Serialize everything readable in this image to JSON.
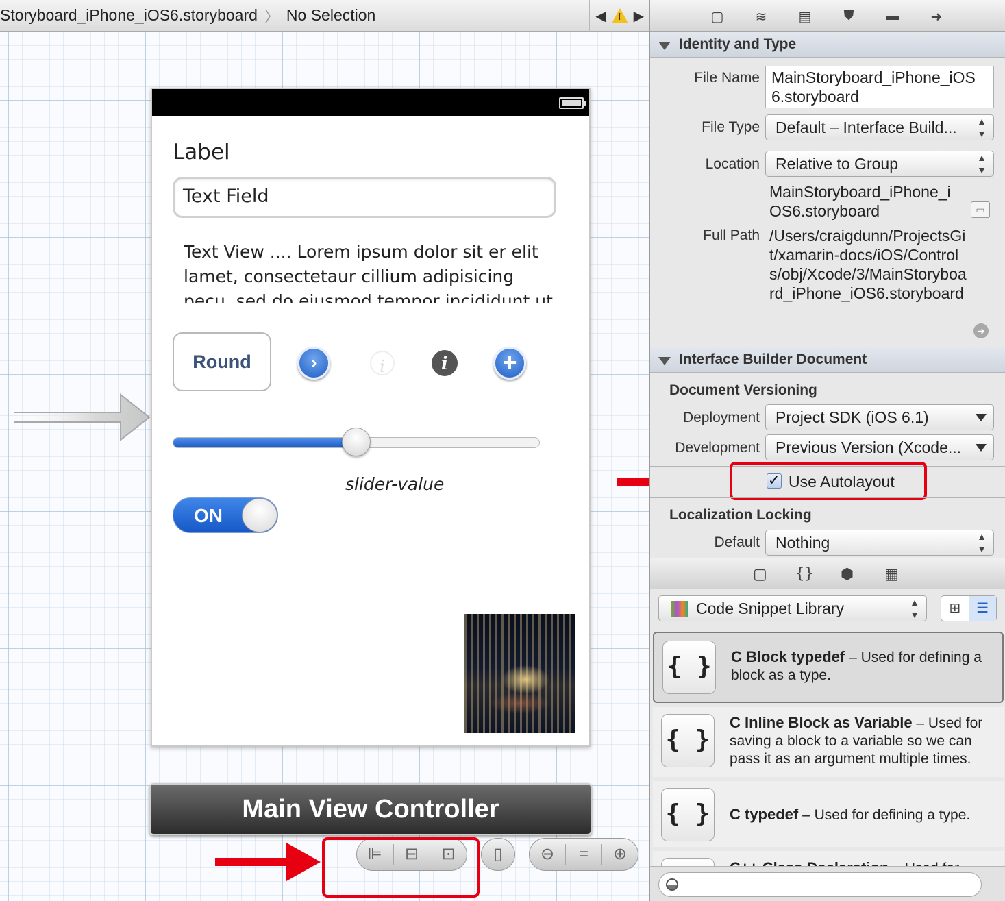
{
  "jumpbar": {
    "file": "Storyboard_iPhone_iOS6.storyboard",
    "selection": "No Selection"
  },
  "canvas": {
    "label": "Label",
    "text_field": "Text Field",
    "text_view": "Text View .... Lorem ipsum dolor sit er elit lamet, consectetaur cillium adipisicing pecu, sed do eiusmod tempor incididunt ut",
    "round_button": "Round",
    "slider_value_label": "slider-value",
    "slider_fraction": 0.5,
    "toggle_label": "ON",
    "view_controller_title": "Main View Controller"
  },
  "inspector": {
    "identity": {
      "header": "Identity and Type",
      "file_name_label": "File Name",
      "file_name": "MainStoryboard_iPhone_iOS6.storyboard",
      "file_type_label": "File Type",
      "file_type": "Default – Interface Build...",
      "location_label": "Location",
      "location": "Relative to Group",
      "relative_path": "MainStoryboard_iPhone_iOS6.storyboard",
      "full_path_label": "Full Path",
      "full_path": "/Users/craigdunn/ProjectsGit/xamarin-docs/iOS/Controls/obj/Xcode/3/MainStoryboard_iPhone_iOS6.storyboard"
    },
    "ib_doc": {
      "header": "Interface Builder Document",
      "versioning": "Document Versioning",
      "deployment_label": "Deployment",
      "deployment": "Project SDK (iOS 6.1)",
      "development_label": "Development",
      "development": "Previous Version (Xcode...",
      "autolayout": "Use Autolayout",
      "autolayout_checked": true,
      "localization": "Localization Locking",
      "default_label": "Default",
      "default_value": "Nothing"
    },
    "library": {
      "selector": "Code Snippet Library",
      "items": [
        {
          "title": "C Block typedef",
          "desc": "Used for defining a block as a type.",
          "icon": "{ }"
        },
        {
          "title": "C Inline Block as Variable",
          "desc": "Used for saving a block to a variable so we can pass it as an argument multiple times.",
          "icon": "{ }"
        },
        {
          "title": "C typedef",
          "desc": "Used for defining a type.",
          "icon": "{ }"
        },
        {
          "title": "C++ Class Declaration",
          "desc": "Used for",
          "icon": "{ }"
        }
      ]
    }
  },
  "colors": {
    "highlight_red": "#e60012",
    "ios_blue": "#1d5dc7"
  }
}
